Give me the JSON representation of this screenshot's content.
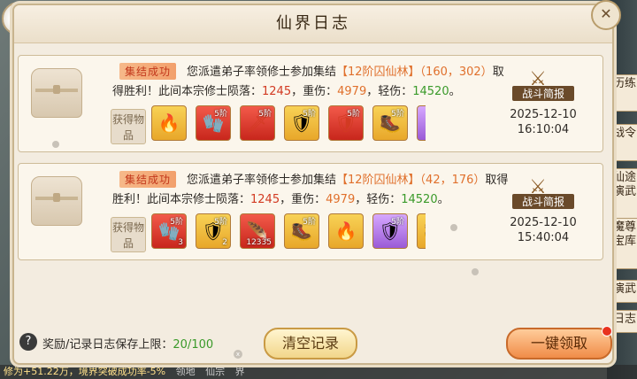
{
  "dialog": {
    "title": "仙界日志",
    "close_icon": "close-icon"
  },
  "logs": [
    {
      "badge": "集结成功",
      "text_pre": "您派遣弟子率领修士参加集结",
      "location": "【12阶囚仙林】（160，302）",
      "text_mid": "取得胜利！此间本宗修士陨落：",
      "fallen": "1245",
      "serious_label": "，重伤：",
      "serious": "4979",
      "light_label": "，轻伤：",
      "light": "14520",
      "end": "。",
      "loot_label": "获得物品",
      "items": [
        {
          "icon": "flame-icon",
          "glyph": "🔥",
          "color": "gold",
          "level": "",
          "count": ""
        },
        {
          "icon": "gauntlet-icon",
          "glyph": "🧤",
          "color": "red",
          "level": "5阶",
          "count": ""
        },
        {
          "icon": "blade-icon",
          "glyph": "🗡",
          "color": "red",
          "level": "5阶",
          "count": ""
        },
        {
          "icon": "armor-icon",
          "glyph": "🛡",
          "color": "gold",
          "level": "5阶",
          "count": ""
        },
        {
          "icon": "armor-red-icon",
          "glyph": "🛡",
          "color": "red",
          "level": "5阶",
          "count": ""
        },
        {
          "icon": "boot-icon",
          "glyph": "🥾",
          "color": "gold",
          "level": "5阶",
          "count": ""
        },
        {
          "icon": "armor-purple-icon",
          "glyph": "🛡",
          "color": "purple",
          "level": "",
          "count": ""
        }
      ],
      "report_label": "战斗简报",
      "date": "2025-12-10",
      "time": "16:10:04"
    },
    {
      "badge": "集结成功",
      "text_pre": "您派遣弟子率领修士参加集结",
      "location": "【12阶囚仙林】（42，176）",
      "text_mid": "取得胜利！此间本宗修士陨落：",
      "fallen": "1245",
      "serious_label": "，重伤：",
      "serious": "4979",
      "light_label": "，轻伤：",
      "light": "14520",
      "end": "。",
      "loot_label": "获得物品",
      "items": [
        {
          "icon": "gauntlet-icon",
          "glyph": "🧤",
          "color": "red",
          "level": "5阶",
          "count": "3"
        },
        {
          "icon": "armor-icon",
          "glyph": "🛡",
          "color": "gold",
          "level": "5阶",
          "count": "2"
        },
        {
          "icon": "phoenix-icon",
          "glyph": "🪶",
          "color": "red",
          "level": "",
          "count": "12335"
        },
        {
          "icon": "boot-icon",
          "glyph": "🥾",
          "color": "gold",
          "level": "5阶",
          "count": ""
        },
        {
          "icon": "flame-icon",
          "glyph": "🔥",
          "color": "gold",
          "level": "",
          "count": ""
        },
        {
          "icon": "armor-purple-icon",
          "glyph": "🛡",
          "color": "purple",
          "level": "5阶",
          "count": ""
        },
        {
          "icon": "boot-gold-icon",
          "glyph": "🥾",
          "color": "gold",
          "level": "5阶",
          "count": ""
        }
      ],
      "report_label": "战斗简报",
      "date": "2025-12-10",
      "time": "15:40:04"
    }
  ],
  "footer": {
    "label": "奖励/记录日志保存上限：",
    "count": "20/100",
    "clear_button": "清空记录",
    "claim_button": "一键领取"
  },
  "side_tabs": [
    "历练",
    "战令",
    "仙途演武",
    "魔尊宝库",
    "演武",
    "日志"
  ],
  "bottom_text": "修为+51.22万，境界突破成功率-5%",
  "bottom_labels": [
    "领地",
    "仙宗",
    "界"
  ]
}
